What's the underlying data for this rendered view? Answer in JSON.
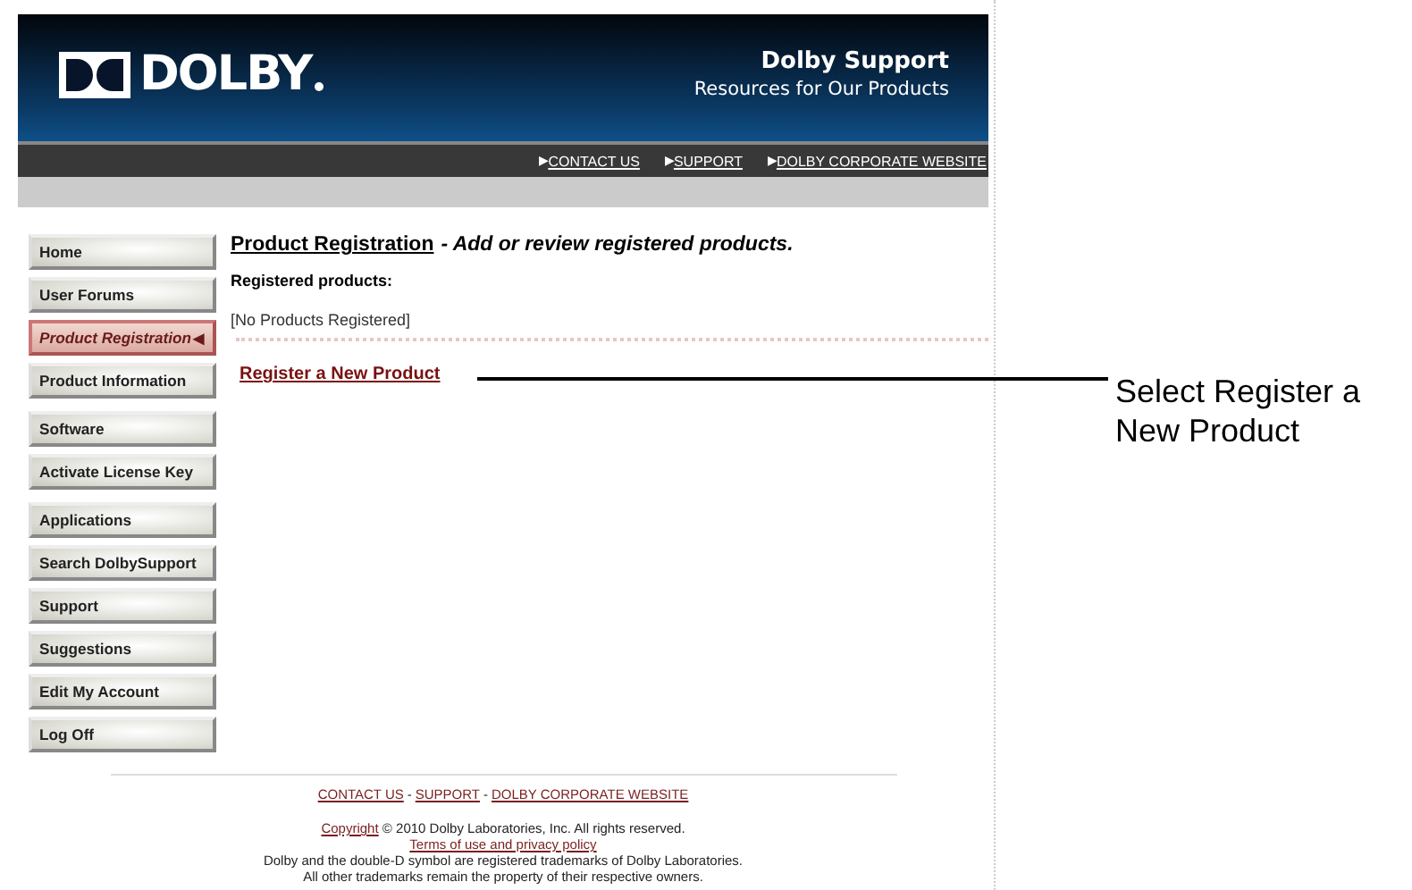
{
  "header": {
    "logo": "DOLBY",
    "title": "Dolby Support",
    "subtitle": "Resources for Our Products"
  },
  "top_links": [
    {
      "marker": "▶",
      "label": "CONTACT US"
    },
    {
      "marker": "▶",
      "label": "SUPPORT"
    },
    {
      "marker": "▶",
      "label": "DOLBY CORPORATE WEBSITE"
    }
  ],
  "sidebar": {
    "items": [
      {
        "label": "Home",
        "selected": false
      },
      {
        "label": "User Forums",
        "selected": false
      },
      {
        "label": "Product Registration",
        "selected": true,
        "marker": "◀"
      },
      {
        "label": "Product Information",
        "selected": false
      },
      {
        "label": "Software",
        "selected": false
      },
      {
        "label": "Activate License Key",
        "selected": false
      },
      {
        "label": "Applications",
        "selected": false
      },
      {
        "label": "Search DolbySupport",
        "selected": false
      },
      {
        "label": "Support",
        "selected": false
      },
      {
        "label": "Suggestions",
        "selected": false
      },
      {
        "label": "Edit My Account",
        "selected": false
      },
      {
        "label": "Log Off",
        "selected": false
      }
    ]
  },
  "content": {
    "heading": "Product Registration",
    "heading_note": "- Add or review registered products.",
    "section_label": "Registered products:",
    "empty_message": "[No Products Registered]",
    "action_link": "Register a New Product"
  },
  "footer": {
    "links": [
      {
        "label": "CONTACT US"
      },
      {
        "label": "SUPPORT"
      },
      {
        "label": "DOLBY CORPORATE WEBSITE"
      }
    ],
    "separator": "-",
    "copyright_link": "Copyright",
    "copyright_text": "© 2010 Dolby Laboratories, Inc. All rights reserved.",
    "terms_link": "Terms of use and privacy policy",
    "trademark_line_1": "Dolby and the double-D symbol are registered trademarks of Dolby Laboratories.",
    "trademark_line_2": "All other trademarks remain the property of their respective owners."
  },
  "callout": {
    "text": "Select Register a New Product"
  }
}
